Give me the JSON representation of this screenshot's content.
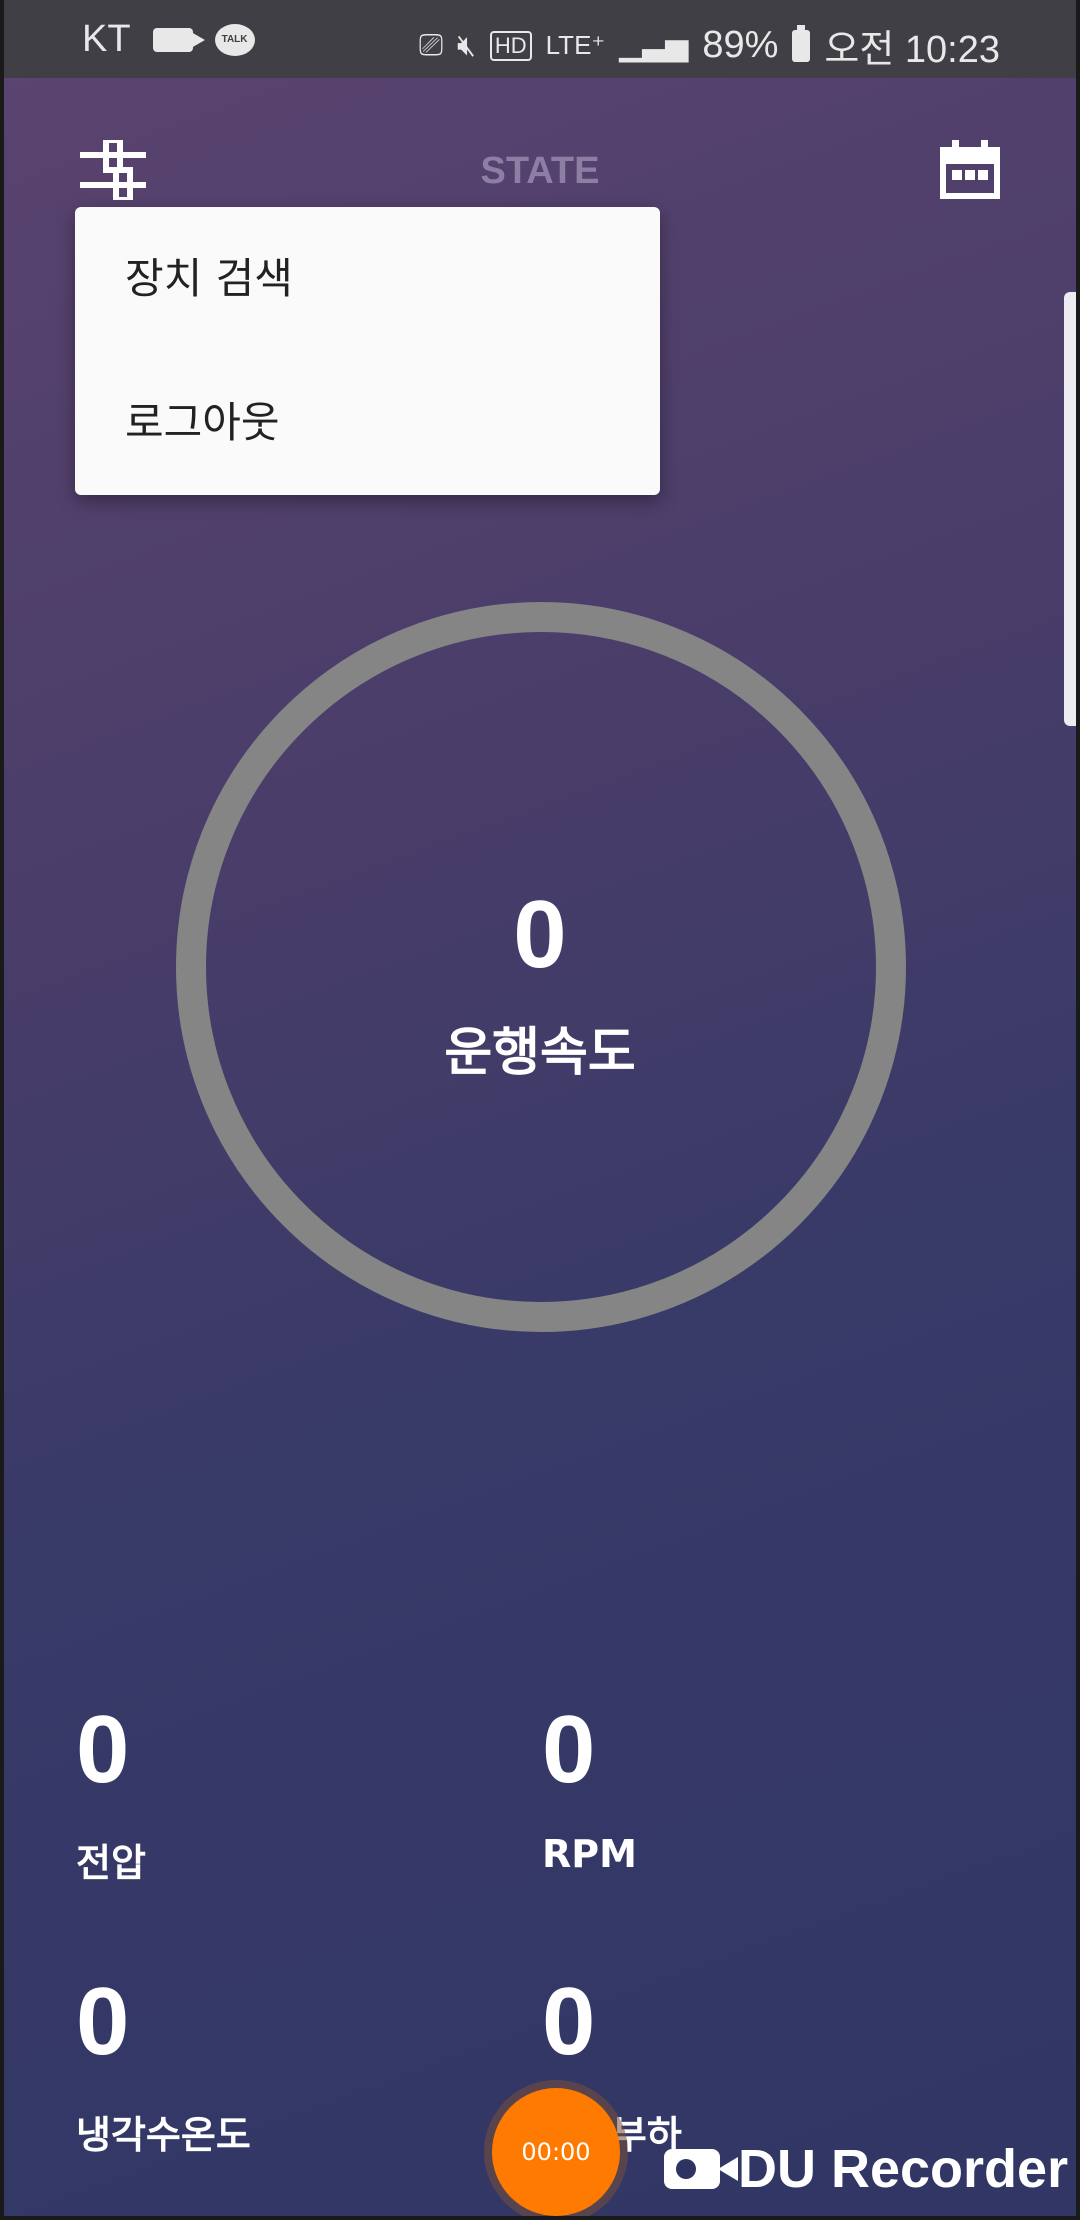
{
  "status_bar": {
    "carrier": "KT",
    "hd_label": "HD",
    "network": "LTE⁺",
    "battery": "89%",
    "time": "오전 10:23"
  },
  "topbar": {
    "title": "STATE"
  },
  "menu": {
    "items": [
      {
        "label": "장치 검색"
      },
      {
        "label": "로그아웃"
      }
    ]
  },
  "gauge": {
    "value": "0",
    "label": "운행속도",
    "ring_color": "#858585"
  },
  "stats": [
    {
      "value": "0",
      "label": "전압"
    },
    {
      "value": "0",
      "label": "RPM"
    },
    {
      "value": "0",
      "label": "냉각수온도"
    },
    {
      "value": "0",
      "label": "엔진부하"
    }
  ],
  "recorder": {
    "timer": "00:00",
    "watermark": "DU Recorder",
    "accent": "#ff7a00"
  }
}
